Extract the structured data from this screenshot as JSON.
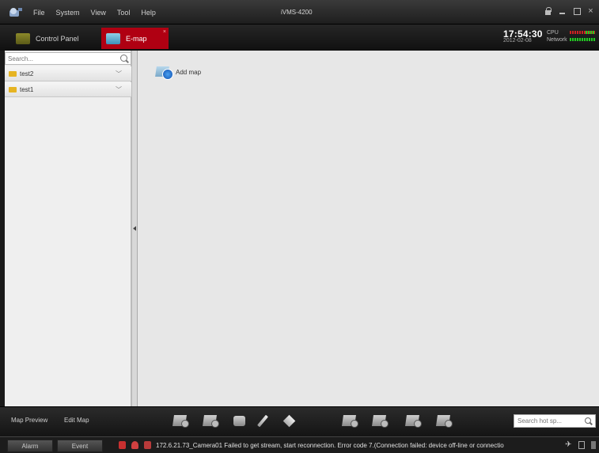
{
  "window": {
    "title": "iVMS-4200",
    "menu": [
      "File",
      "System",
      "View",
      "Tool",
      "Help"
    ]
  },
  "tabs": [
    {
      "label": "Control Panel",
      "active": false
    },
    {
      "label": "E-map",
      "active": true
    }
  ],
  "status_info": {
    "time": "17:54:30",
    "date": "2012-02-08",
    "cpu_label": "CPU",
    "network_label": "Network"
  },
  "left_panel": {
    "search_placeholder": "Search...",
    "items": [
      {
        "label": "test2"
      },
      {
        "label": "test1"
      }
    ]
  },
  "main": {
    "add_map_label": "Add map"
  },
  "bottom_toolbar": {
    "map_preview_label": "Map Preview",
    "edit_map_label": "Edit Map",
    "tools": [
      "edit-map-icon",
      "delete-map-icon",
      "add-camera-icon",
      "pen-icon",
      "eraser-icon",
      "add-hotspot-icon",
      "add-hotregion-icon",
      "modify-hotspot-icon",
      "delete-hotspot-icon"
    ],
    "hotspot_search_placeholder": "Search hot sp..."
  },
  "status_bar": {
    "alarm_tab": "Alarm",
    "event_tab": "Event",
    "message": "172.6.21.73_Camera01 Failed to get stream, start reconnection. Error code 7.(Connection failed: device off-line or connectio"
  },
  "colors": {
    "accent_red": "#b00012",
    "canvas_bg": "#e7e7e7",
    "panel_bg": "#efefef"
  }
}
